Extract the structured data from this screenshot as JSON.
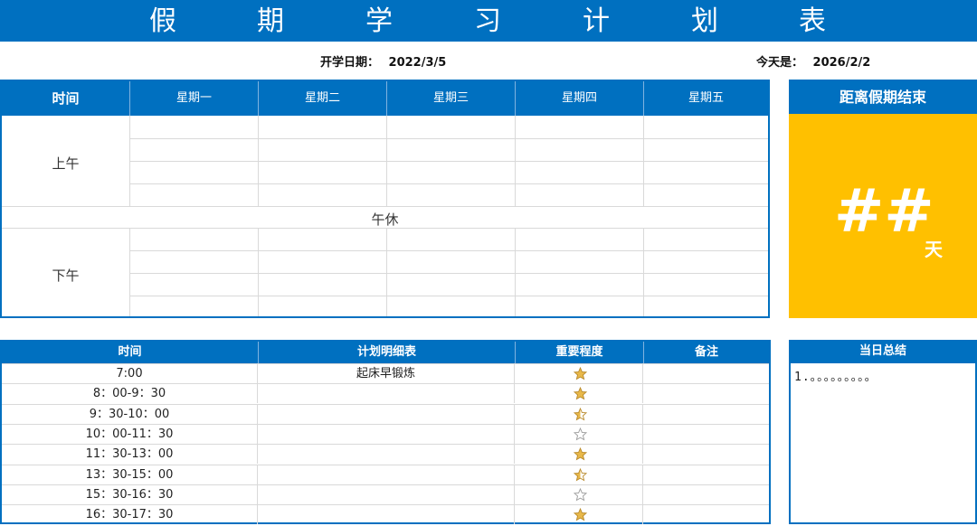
{
  "title_chars": [
    "假",
    "期",
    "学",
    "习",
    "计",
    "划",
    "表"
  ],
  "start_date": {
    "label": "开学日期：",
    "value": "2022/3/5"
  },
  "today": {
    "label": "今天是：",
    "value": "2026/2/2"
  },
  "schedule": {
    "time_header": "时间",
    "days": [
      "星期一",
      "星期二",
      "星期三",
      "星期四",
      "星期五"
    ],
    "morning_label": "上午",
    "noon_label": "午休",
    "afternoon_label": "下午"
  },
  "countdown": {
    "title": "距离假期结束",
    "value": "##",
    "unit": "天"
  },
  "plan_table": {
    "headers": [
      "时间",
      "计划明细表",
      "重要程度",
      "备注"
    ],
    "rows": [
      {
        "time": "7:00",
        "detail": "起床早锻炼",
        "rating": 1,
        "note": ""
      },
      {
        "time": "8：00-9：30",
        "detail": "",
        "rating": 1,
        "note": ""
      },
      {
        "time": "9：30-10：00",
        "detail": "",
        "rating": 0.5,
        "note": ""
      },
      {
        "time": "10：00-11：30",
        "detail": "",
        "rating": 0,
        "note": ""
      },
      {
        "time": "11：30-13：00",
        "detail": "",
        "rating": 1,
        "note": ""
      },
      {
        "time": "13：30-15：00",
        "detail": "",
        "rating": 0.5,
        "note": ""
      },
      {
        "time": "15：30-16：30",
        "detail": "",
        "rating": 0,
        "note": ""
      },
      {
        "time": "16：30-17：30",
        "detail": "",
        "rating": 1,
        "note": ""
      }
    ]
  },
  "summary": {
    "title": "当日总结",
    "text": "1.。。。。。。。。。"
  },
  "colors": {
    "header_blue": "#0070c0",
    "countdown_yellow": "#ffc000",
    "star_gold": "#e8b84a"
  }
}
